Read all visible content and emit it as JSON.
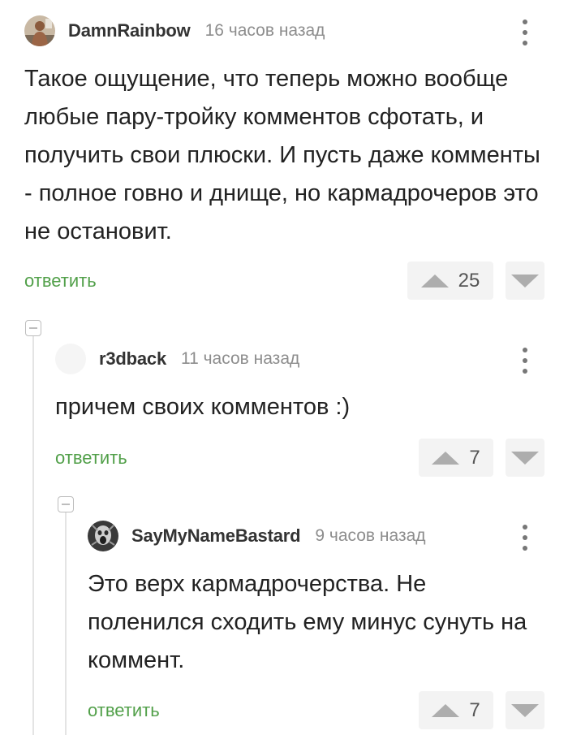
{
  "comments": [
    {
      "username": "DamnRainbow",
      "time": "16 часов назад",
      "text": "Такое ощущение, что теперь можно вообще любые пару-тройку комментов сфотать, и получить свои плюски. И пусть даже комменты - полное говно и днище, но кармадрочеров это не остановит.",
      "reply_label": "ответить",
      "votes": "25"
    },
    {
      "username": "r3dback",
      "time": "11 часов назад",
      "text": "причем своих комментов :)",
      "reply_label": "ответить",
      "votes": "7"
    },
    {
      "username": "SayMyNameBastard",
      "time": "9 часов назад",
      "text": "Это верх кармадрочерства. Не поленился сходить ему минус сунуть на коммент.",
      "reply_label": "ответить",
      "votes": "7"
    }
  ],
  "colors": {
    "reply": "#52a04a",
    "meta": "#8d8d8d",
    "vote_bg": "#f3f3f3",
    "arrow": "#adadad"
  }
}
